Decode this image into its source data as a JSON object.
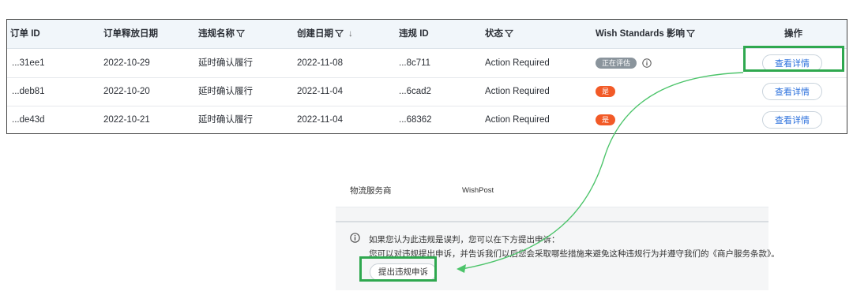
{
  "table": {
    "headers": [
      {
        "label": "订单 ID",
        "filter": false,
        "sort": false
      },
      {
        "label": "订单释放日期",
        "filter": false,
        "sort": false
      },
      {
        "label": "违规名称",
        "filter": true,
        "sort": false
      },
      {
        "label": "创建日期",
        "filter": true,
        "sort": true
      },
      {
        "label": "违规 ID",
        "filter": false,
        "sort": false
      },
      {
        "label": "状态",
        "filter": true,
        "sort": false
      },
      {
        "label": "Wish Standards 影响",
        "filter": true,
        "sort": false
      },
      {
        "label": "操作",
        "filter": false,
        "sort": false
      }
    ],
    "sort_arrow": "↓",
    "rows": [
      {
        "order_id": "...31ee1",
        "release_date": "2022-10-29",
        "violation_name": "延时确认履行",
        "created": "2022-11-08",
        "violation_id": "...8c711",
        "status": "Action Required",
        "impact": "正在评估",
        "impact_color": "#8a949c",
        "impact_info_icon": true,
        "action": "查看详情"
      },
      {
        "order_id": "...deb81",
        "release_date": "2022-10-20",
        "violation_name": "延时确认履行",
        "created": "2022-11-04",
        "violation_id": "...6cad2",
        "status": "Action Required",
        "impact": "是",
        "impact_color": "#f25a27",
        "impact_info_icon": false,
        "action": "查看详情"
      },
      {
        "order_id": "...de43d",
        "release_date": "2022-10-21",
        "violation_name": "延时确认履行",
        "created": "2022-11-04",
        "violation_id": "...68362",
        "status": "Action Required",
        "impact": "是",
        "impact_color": "#f25a27",
        "impact_info_icon": false,
        "action": "查看详情"
      }
    ]
  },
  "detail_panel": {
    "carrier_label": "物流服务商",
    "carrier_value": "WishPost",
    "appeal_line1": "如果您认为此违规是误判，您可以在下方提出申诉：",
    "appeal_line2": "您可以对违规提出申诉，并告诉我们以后您会采取哪些措施来避免这种违规行为并遵守我们的《商户服务条款》。",
    "appeal_button": "提出违规申诉"
  },
  "colors": {
    "highlight": "#2fa84f",
    "link_blue": "#2a6fdc",
    "header_bg": "#f1f6fa"
  },
  "icons": [
    "filter-icon",
    "sort-down-icon",
    "info-icon",
    "arrow-icon"
  ]
}
